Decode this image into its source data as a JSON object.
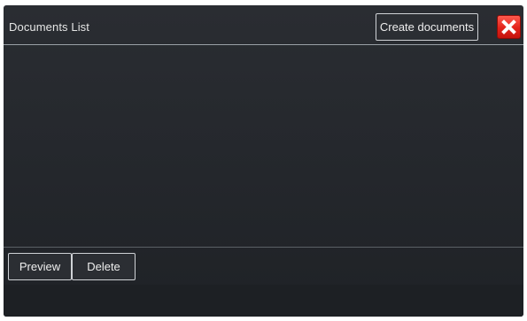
{
  "window": {
    "title": "Documents List"
  },
  "header": {
    "create_label": "Create documents",
    "close_icon": "close-icon"
  },
  "footer": {
    "preview_label": "Preview",
    "delete_label": "Delete"
  },
  "colors": {
    "background": "#24272c",
    "close_button": "#e2231a",
    "text": "#e6e6e6"
  }
}
